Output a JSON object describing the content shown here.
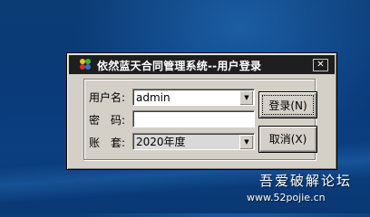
{
  "window": {
    "title": "依然蓝天合同管理系统--用户登录",
    "close_glyph": "✕"
  },
  "form": {
    "username_label": "用户名:",
    "username_value": "admin",
    "password_label": "密　码:",
    "password_value": "",
    "account_label": "账　套:",
    "account_value": "2020年度"
  },
  "buttons": {
    "login_label": "登录(N)",
    "cancel_label": "取消(X)"
  },
  "watermark": {
    "site_name": "吾爱破解论坛",
    "url": "www.52pojie.cn"
  },
  "icons": {
    "app": "multicolor-app-icon",
    "dropdown": "chevron-down-icon"
  },
  "colors": {
    "desktop": "#0b3f80",
    "titlebar": "#1e1e1e",
    "dialog_face": "#d4d0c8"
  }
}
